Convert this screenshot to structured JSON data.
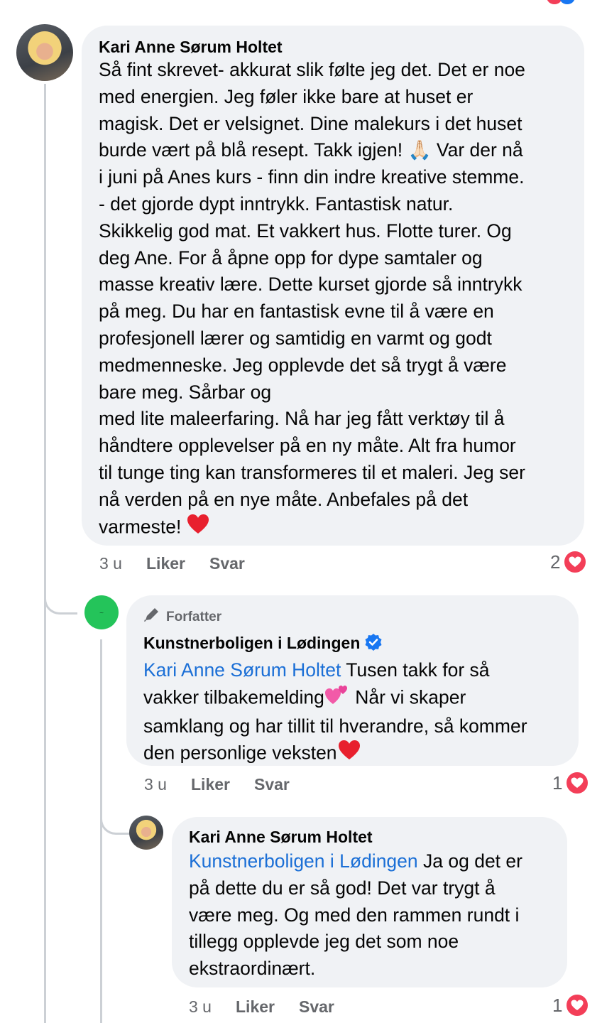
{
  "colors": {
    "bubble": "#f0f2f5",
    "mention": "#1b6fd6",
    "meta": "#65676b",
    "heart": "#f33e58",
    "verified": "#1877f2",
    "page_avatar": "#24c45a"
  },
  "comment1": {
    "author": "Kari Anne Sørum Holtet",
    "text": "Så fint skrevet- akkurat slik følte jeg det. Det er noe\nmed energien. Jeg føler ikke bare at huset er\nmagisk. Det er velsignet. Dine malekurs i det huset\nburde vært på blå resept. Takk igjen! 🙏🏻 Var der nå\ni juni på Anes kurs - finn din indre kreative stemme.\n- det gjorde dypt inntrykk. Fantastisk natur.\nSkikkelig god mat. Et vakkert hus. Flotte turer. Og\ndeg Ane. For å åpne opp for dype samtaler og\nmasse kreativ lære. Dette kurset gjorde så inntrykk\npå meg. Du har en fantastisk evne til å være en\nprofesjonell lærer og samtidig en varmt og godt\nmedmenneske. Jeg opplevde det så trygt å være\nbare meg. Sårbar og\nmed lite maleerfaring. Nå har jeg fått verktøy til å\nhåndtere opplevelser på en ny måte. Alt fra humor\ntil tunge ting kan transformeres til et maleri. Jeg ser\nnå verden på en nye måte. Anbefales på det\nvarmeste!",
    "time": "3 u",
    "like_label": "Liker",
    "reply_label": "Svar",
    "reaction_count": "2",
    "reaction_icon": "heart-icon"
  },
  "reply1": {
    "tag": "Forfatter",
    "tag_icon": "pencil-icon",
    "author": "Kunstnerboligen i Lødingen",
    "mention": "Kari Anne Sørum Holtet",
    "text_a": " Tusen takk for så\nvakker tilbakemelding",
    "text_b": " Når vi skaper\nsamklang og har tillit til hverandre, så kommer\nden personlige veksten",
    "time": "3 u",
    "like_label": "Liker",
    "reply_label": "Svar",
    "reaction_count": "1",
    "reaction_icon": "heart-icon"
  },
  "reply2": {
    "author": "Kari Anne Sørum Holtet",
    "mention": "Kunstnerboligen i Lødingen",
    "text": " Ja og det er\npå dette du er så god! Det var trygt å\nvære meg. Og med den rammen rundt i\ntillegg opplevde jeg det som noe\nekstraordinært.",
    "time": "3 u",
    "like_label": "Liker",
    "reply_label": "Svar",
    "reaction_count": "1",
    "reaction_icon": "heart-icon"
  }
}
